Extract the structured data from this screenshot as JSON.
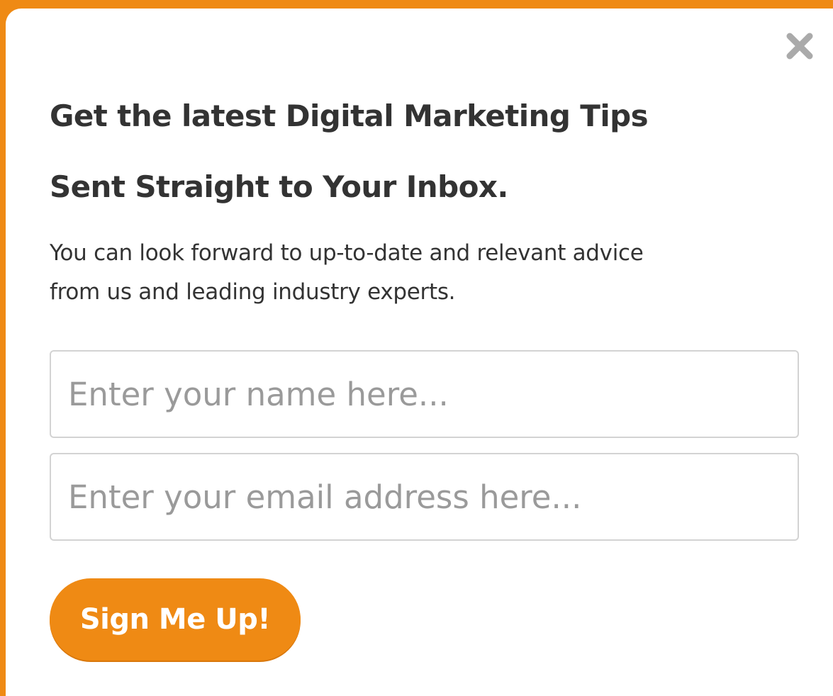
{
  "popup": {
    "close_icon": "close-icon",
    "title_line1": "Get the latest Digital Marketing Tips",
    "title_line2": "Sent Straight to Your Inbox.",
    "description_line1": "You can look forward to up-to-date and relevant advice",
    "description_line2": "from us and leading industry experts.",
    "name_placeholder": "Enter your name here...",
    "name_value": "",
    "email_placeholder": "Enter your email address here...",
    "email_value": "",
    "submit_label": "Sign Me Up!"
  },
  "colors": {
    "accent": "#ef8a14",
    "background": "#ffffff",
    "text": "#333333",
    "placeholder": "#9a9a9a",
    "border": "#d3d3d3",
    "close_icon": "#aaaaaa"
  }
}
